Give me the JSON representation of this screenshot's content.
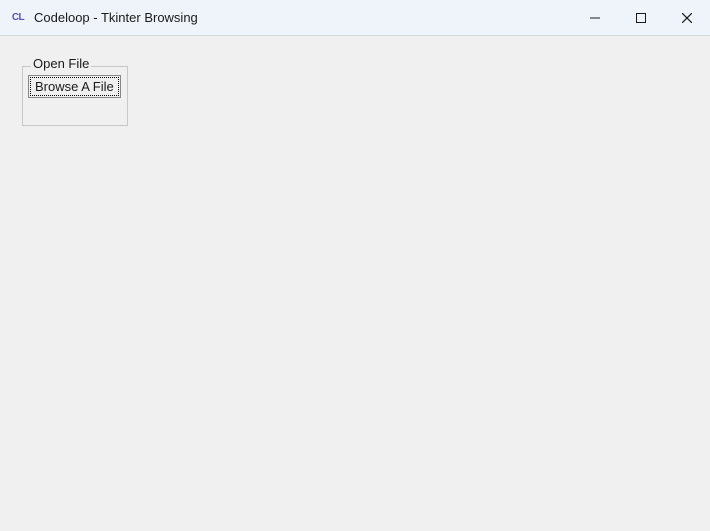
{
  "window": {
    "app_icon_label": "CL",
    "title": "Codeloop - Tkinter Browsing"
  },
  "frame": {
    "label": "Open File",
    "button_label": "Browse A File"
  }
}
